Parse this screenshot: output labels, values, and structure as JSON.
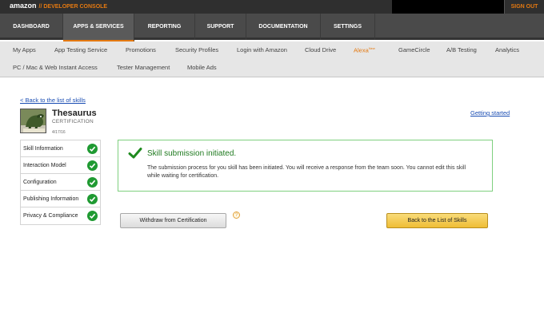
{
  "topbar": {
    "brand": "amazon",
    "console": "// DEVELOPER CONSOLE",
    "signout": "SIGN OUT"
  },
  "mainnav": {
    "items": [
      {
        "label": "DASHBOARD"
      },
      {
        "label": "APPS & SERVICES",
        "active": true
      },
      {
        "label": "REPORTING"
      },
      {
        "label": "SUPPORT"
      },
      {
        "label": "DOCUMENTATION"
      },
      {
        "label": "SETTINGS"
      }
    ]
  },
  "subnav": {
    "items": [
      {
        "label": "My Apps"
      },
      {
        "label": "App Testing Service"
      },
      {
        "label": "Promotions"
      },
      {
        "label": "Security Profiles"
      },
      {
        "label": "Login with Amazon"
      },
      {
        "label": "Cloud Drive"
      },
      {
        "label": "Alexa",
        "badge": "New"
      },
      {
        "label": "GameCircle"
      },
      {
        "label": "A/B Testing"
      },
      {
        "label": "Analytics"
      },
      {
        "label": "PC / Mac & Web Instant Access"
      },
      {
        "label": "Tester Management"
      },
      {
        "label": "Mobile Ads"
      }
    ]
  },
  "page": {
    "back_link": "< Back to the list of skills",
    "getting_started": "Getting started"
  },
  "skill": {
    "name": "Thesaurus",
    "status": "CERTIFICATION",
    "date": "4/17/16"
  },
  "steps": [
    {
      "label": "Skill Information",
      "complete": true
    },
    {
      "label": "Interaction Model",
      "complete": true
    },
    {
      "label": "Configuration",
      "complete": true
    },
    {
      "label": "Publishing Information",
      "complete": true
    },
    {
      "label": "Privacy & Compliance",
      "complete": true
    }
  ],
  "message": {
    "title": "Skill submission initiated.",
    "body": "The submission process for you skill has been initiated. You will receive a response from the team soon. You cannot edit this skill while waiting for certification."
  },
  "actions": {
    "withdraw_label": "Withdraw from Certification",
    "help_label": "?",
    "back_label": "Back to the List of Skills"
  },
  "colors": {
    "accent": "#e47911",
    "success": "#1f9a32",
    "link": "#1a4db3"
  }
}
